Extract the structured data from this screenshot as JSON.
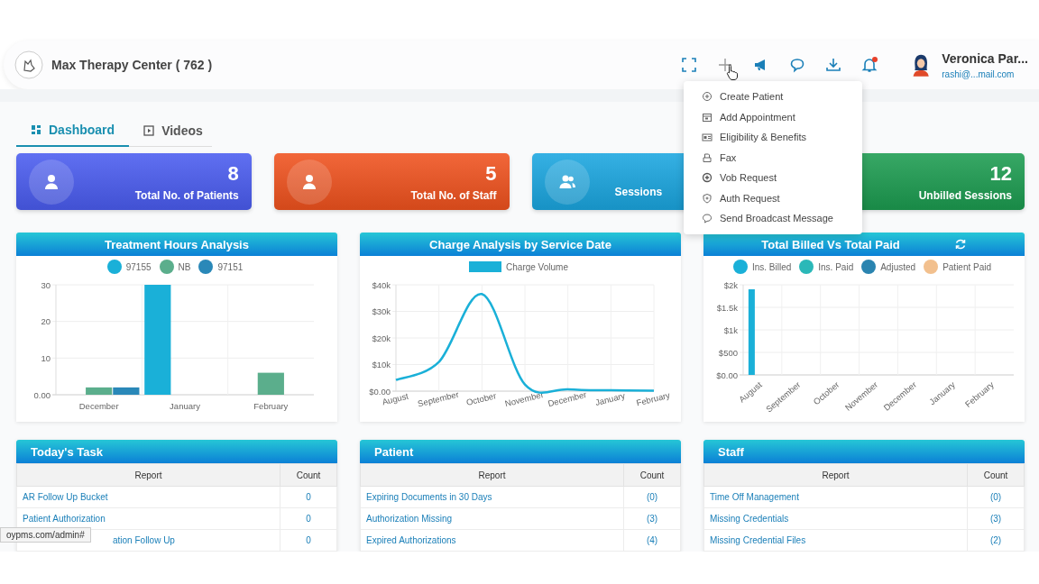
{
  "header": {
    "org_name": "Max Therapy Center ( 762 )",
    "user_name": "Veronica Par...",
    "user_email": "rashi@...mail.com"
  },
  "add_menu": {
    "items": [
      {
        "label": "Create Patient"
      },
      {
        "label": "Add Appointment"
      },
      {
        "label": "Eligibility & Benefits"
      },
      {
        "label": "Fax"
      },
      {
        "label": "Vob Request"
      },
      {
        "label": "Auth Request"
      },
      {
        "label": "Send Broadcast Message"
      }
    ]
  },
  "tabs": [
    {
      "label": "Dashboard",
      "selected": true
    },
    {
      "label": "Videos",
      "selected": false
    }
  ],
  "stat_cards": [
    {
      "kind": "full",
      "value": "8",
      "label": "Total No. of Patients",
      "color": "#4a5cf0"
    },
    {
      "kind": "full",
      "value": "5",
      "label": "Total No. of Staff",
      "color": "#f0521e"
    },
    {
      "kind": "covered_right",
      "label": "Sessions",
      "color": "#1aa6e0"
    },
    {
      "kind": "covered_left",
      "value": "12",
      "label": "Unbilled Sessions",
      "color": "#1c9c50"
    }
  ],
  "charts": [
    {
      "title": "Treatment Hours Analysis",
      "refresh_button": false,
      "chart_data": {
        "type": "bar",
        "categories": [
          "December",
          "January",
          "February"
        ],
        "series": [
          {
            "name": "97155",
            "color": "#1ab0d8",
            "values": [
              null,
              30,
              null
            ]
          },
          {
            "name": "NB",
            "color": "#5bae8c",
            "values": [
              2,
              null,
              6
            ]
          },
          {
            "name": "97151",
            "color": "#2a88b8",
            "values": [
              2,
              null,
              null
            ]
          }
        ],
        "grid": true,
        "ylim": [
          0,
          30
        ],
        "yticks": [
          {
            "value": 0,
            "label": "0.00"
          },
          10,
          20,
          30
        ]
      }
    },
    {
      "title": "Charge Analysis by Service Date",
      "refresh_button": false,
      "chart_data": {
        "type": "line",
        "categories": [
          "August",
          "September",
          "October",
          "November",
          "December",
          "January",
          "February"
        ],
        "series": [
          {
            "name": "Charge Volume",
            "color": "#1ab0d8",
            "values": [
              4200,
              11000,
              36500,
              2500,
              700,
              300,
              200
            ]
          }
        ],
        "grid": true,
        "ylim": [
          0,
          40000
        ],
        "yticks": [
          {
            "value": 0,
            "label": "$0.00"
          },
          {
            "value": 10000,
            "label": "$10k"
          },
          {
            "value": 20000,
            "label": "$20k"
          },
          {
            "value": 30000,
            "label": "$30k"
          },
          {
            "value": 40000,
            "label": "$40k"
          }
        ]
      }
    },
    {
      "title": "Total Billed Vs Total Paid",
      "refresh_button": true,
      "chart_data": {
        "type": "bar",
        "categories": [
          "August",
          "September",
          "October",
          "November",
          "December",
          "January",
          "February"
        ],
        "series": [
          {
            "name": "Ins. Billed",
            "color": "#1ab0d8",
            "values": [
              1900,
              0,
              0,
              0,
              0,
              0,
              0
            ]
          },
          {
            "name": "Ins. Paid",
            "color": "#2bb8b8",
            "values": [
              0,
              0,
              0,
              0,
              0,
              0,
              0
            ]
          },
          {
            "name": "Adjusted",
            "color": "#2a84b0",
            "values": [
              0,
              0,
              0,
              0,
              0,
              0,
              0
            ]
          },
          {
            "name": "Patient Paid",
            "color": "#f2c08e",
            "values": [
              0,
              0,
              0,
              0,
              0,
              0,
              0
            ]
          }
        ],
        "grid": true,
        "ylim": [
          0,
          2000
        ],
        "yticks": [
          {
            "value": 0,
            "label": "$0.00"
          },
          {
            "value": 500,
            "label": "$500"
          },
          {
            "value": 1000,
            "label": "$1k"
          },
          {
            "value": 1500,
            "label": "$1.5k"
          },
          {
            "value": 2000,
            "label": "$2k"
          }
        ]
      }
    }
  ],
  "tables": [
    {
      "title": "Today's Task",
      "columns": [
        "Report",
        "Count"
      ],
      "rows": [
        [
          "AR Follow Up Bucket",
          "0"
        ],
        [
          "Patient Authorization",
          "0"
        ],
        [
          "ation Follow Up",
          "0"
        ]
      ]
    },
    {
      "title": "Patient",
      "columns": [
        "Report",
        "Count"
      ],
      "rows": [
        [
          "Expiring Documents in 30 Days",
          "(0)"
        ],
        [
          "Authorization Missing",
          "(3)"
        ],
        [
          "Expired Authorizations",
          "(4)"
        ]
      ]
    },
    {
      "title": "Staff",
      "columns": [
        "Report",
        "Count"
      ],
      "rows": [
        [
          "Time Off Management",
          "(0)"
        ],
        [
          "Missing Credentials",
          "(3)"
        ],
        [
          "Missing Credential Files",
          "(2)"
        ]
      ]
    }
  ],
  "status_url": "oypms.com/admin#"
}
